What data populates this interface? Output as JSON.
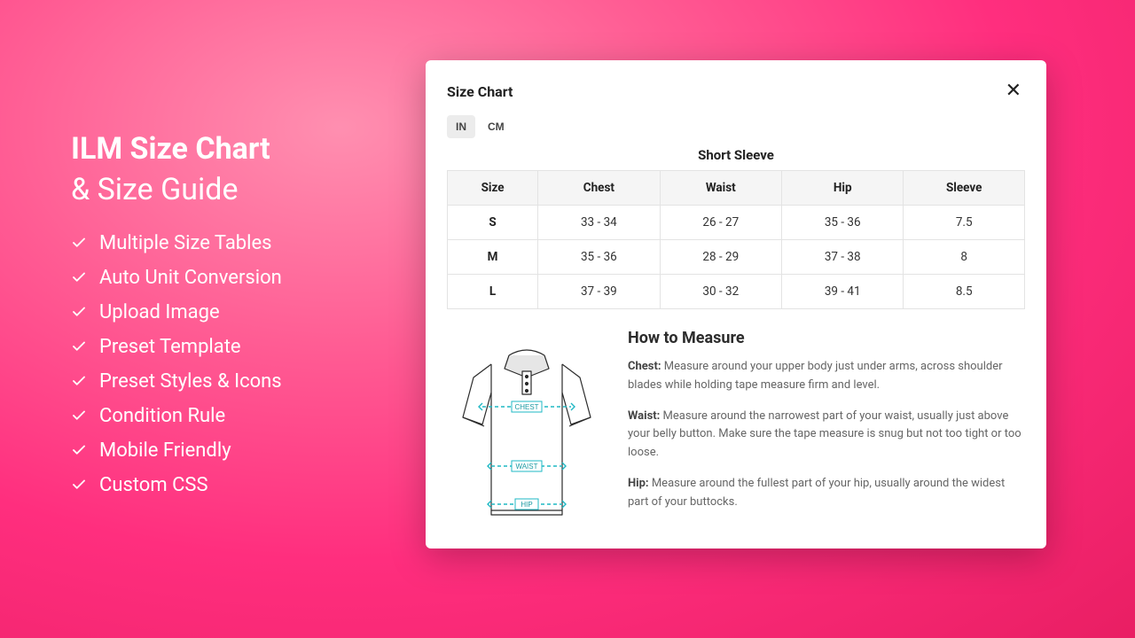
{
  "left": {
    "title_line1": "ILM Size Chart",
    "title_line2": "& Size Guide",
    "features": [
      "Multiple Size Tables",
      "Auto Unit Conversion",
      "Upload Image",
      "Preset Template",
      "Preset Styles & Icons",
      "Condition Rule",
      "Mobile Friendly",
      "Custom CSS"
    ]
  },
  "modal": {
    "title": "Size Chart",
    "unit_in": "IN",
    "unit_cm": "CM",
    "table_title": "Short Sleeve",
    "headers": [
      "Size",
      "Chest",
      "Waist",
      "Hip",
      "Sleeve"
    ],
    "rows": [
      [
        "S",
        "33 - 34",
        "26 - 27",
        "35 - 36",
        "7.5"
      ],
      [
        "M",
        "35 - 36",
        "28 - 29",
        "37 - 38",
        "8"
      ],
      [
        "L",
        "37 - 39",
        "30 - 32",
        "39 - 41",
        "8.5"
      ]
    ],
    "shirt_labels": {
      "chest": "CHEST",
      "waist": "WAIST",
      "hip": "HIP"
    },
    "measure": {
      "heading": "How to Measure",
      "chest_label": "Chest:",
      "chest_text": " Measure around your upper body just under arms, across shoulder blades while holding tape measure firm and level.",
      "waist_label": "Waist:",
      "waist_text": " Measure around the narrowest part of your waist, usually just above your belly button. Make sure the tape measure is snug but not too tight or too loose.",
      "hip_label": "Hip:",
      "hip_text": " Measure around the fullest part of your hip, usually around the widest part of your buttocks."
    }
  }
}
